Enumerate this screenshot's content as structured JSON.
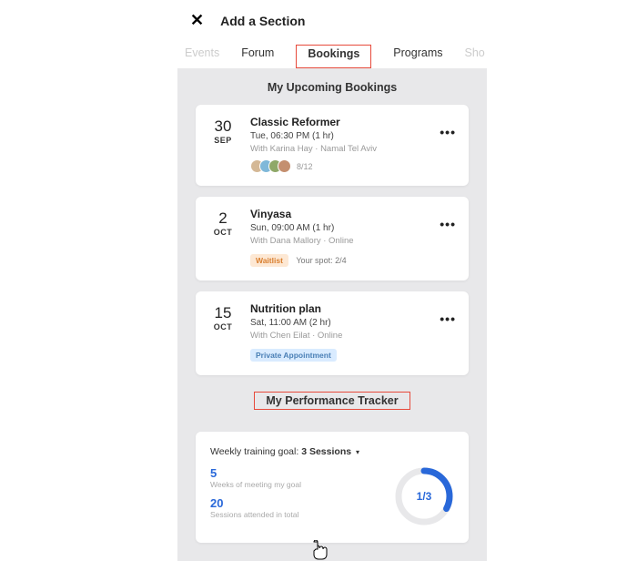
{
  "header": {
    "title": "Add a Section"
  },
  "tabs": [
    {
      "label": "Events",
      "faded": true
    },
    {
      "label": "Forum"
    },
    {
      "label": "Bookings",
      "highlighted": true,
      "active": true
    },
    {
      "label": "Programs"
    },
    {
      "label": "Sho",
      "faded": true
    }
  ],
  "upcoming": {
    "title": "My Upcoming Bookings",
    "items": [
      {
        "day": "30",
        "month": "SEP",
        "name": "Classic Reformer",
        "time": "Tue, 06:30 PM (1 hr)",
        "with": "With Karina Hay · Namal Tel Aviv",
        "avatars_count": "8/12"
      },
      {
        "day": "2",
        "month": "OCT",
        "name": "Vinyasa",
        "time": "Sun, 09:00 AM (1 hr)",
        "with": "With Dana Mallory · Online",
        "badge": "Waitlist",
        "badge_type": "orange",
        "spot": "Your spot: 2/4"
      },
      {
        "day": "15",
        "month": "OCT",
        "name": "Nutrition plan",
        "time": "Sat, 11:00 AM (2 hr)",
        "with": "With Chen Eilat · Online",
        "badge": "Private Appointment",
        "badge_type": "blue"
      }
    ]
  },
  "tracker": {
    "title": "My Performance Tracker",
    "goal_label": "Weekly training goal: ",
    "goal_value": "3 Sessions",
    "stats": [
      {
        "num": "5",
        "label": "Weeks of meeting my goal"
      },
      {
        "num": "20",
        "label": "Sessions attended in total"
      }
    ],
    "progress_label": "1/3"
  }
}
